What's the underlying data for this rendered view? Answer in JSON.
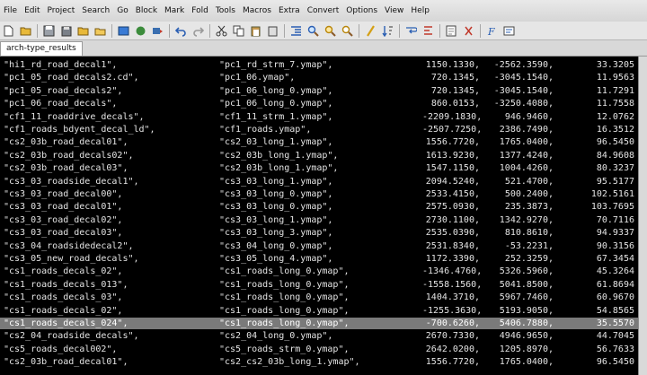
{
  "menu": [
    "File",
    "Edit",
    "Project",
    "Search",
    "Go",
    "Block",
    "Mark",
    "Fold",
    "Tools",
    "Macros",
    "Extra",
    "Convert",
    "Options",
    "View",
    "Help"
  ],
  "tab": {
    "label": "arch-type_results"
  },
  "rows": [
    [
      "\"hi1_rd_road_decal1\",",
      "\"pc1_rd_strm_7.ymap\",",
      "1150.1330,",
      "-2562.3590,",
      "33.3205"
    ],
    [
      "\"pc1_05_road_decals2.cd\",",
      "\"pc1_06.ymap\",",
      "720.1345,",
      "-3045.1540,",
      "11.9563"
    ],
    [
      "\"pc1_05_road_decals2\",",
      "\"pc1_06_long_0.ymap\",",
      "720.1345,",
      "-3045.1540,",
      "11.7291"
    ],
    [
      "\"pc1_06_road_decals\",",
      "\"pc1_06_long_0.ymap\",",
      "860.0153,",
      "-3250.4080,",
      "11.7558"
    ],
    [
      "\"cf1_11_roaddrive_decals\",",
      "\"cf1_11_strm_1.ymap\",",
      "-2209.1830,",
      "946.9460,",
      "12.0762"
    ],
    [
      "\"cf1_roads_bdyent_decal_ld\",",
      "\"cf1_roads.ymap\",",
      "-2507.7250,",
      "2386.7490,",
      "16.3512"
    ],
    [
      "\"cs2_03b_road_decal01\",",
      "\"cs2_03_long_1.ymap\",",
      "1556.7720,",
      "1765.0400,",
      "96.5450"
    ],
    [
      "\"cs2_03b_road_decals02\",",
      "\"cs2_03b_long_1.ymap\",",
      "1613.9230,",
      "1377.4240,",
      "84.9608"
    ],
    [
      "\"cs2_03b_road_decal03\",",
      "\"cs2_03b_long_1.ymap\",",
      "1547.1150,",
      "1004.4260,",
      "80.3237"
    ],
    [
      "\"cs3_03_roadside_decal1\",",
      "\"cs3_03_long_1.ymap\",",
      "2094.5240,",
      "521.4700,",
      "95.5177"
    ],
    [
      "\"cs3_03_road_decal00\",",
      "\"cs3_03_long_0.ymap\",",
      "2533.4150,",
      "500.2400,",
      "102.5161"
    ],
    [
      "\"cs3_03_road_decal01\",",
      "\"cs3_03_long_0.ymap\",",
      "2575.0930,",
      "235.3873,",
      "103.7695"
    ],
    [
      "\"cs3_03_road_decal02\",",
      "\"cs3_03_long_1.ymap\",",
      "2730.1100,",
      "1342.9270,",
      "70.7116"
    ],
    [
      "\"cs3_03_road_decal03\",",
      "\"cs3_03_long_3.ymap\",",
      "2535.0390,",
      "810.8610,",
      "94.9337"
    ],
    [
      "\"cs3_04_roadsidedecal2\",",
      "\"cs3_04_long_0.ymap\",",
      "2531.8340,",
      "-53.2231,",
      "90.3156"
    ],
    [
      "\"cs3_05_new_road_decals\",",
      "\"cs3_05_long_4.ymap\",",
      "1172.3390,",
      "252.3259,",
      "67.3454"
    ],
    [
      "\"cs1_roads_decals_02\",",
      "\"cs1_roads_long_0.ymap\",",
      "-1346.4760,",
      "5326.5960,",
      "45.3264"
    ],
    [
      "\"cs1_roads_decals_013\",",
      "\"cs1_roads_long_0.ymap\",",
      "-1558.1560,",
      "5041.8500,",
      "61.8694"
    ],
    [
      "\"cs1_roads_decals_03\",",
      "\"cs1_roads_long_0.ymap\",",
      "1404.3710,",
      "5967.7460,",
      "60.9670"
    ],
    [
      "\"cs1_roads_decals_02\",",
      "\"cs1_roads_long_0.ymap\",",
      "-1255.3630,",
      "5193.9050,",
      "54.8565"
    ],
    [
      "\"cs1_roads_decals_024\",",
      "\"cs1_roads_long_0.ymap\",",
      "-700.6260,",
      "5406.7880,",
      "35.5570"
    ],
    [
      "\"cs2_04_roadside_decals\",",
      "\"cs2_04_long_0.ymap\",",
      "2670.7330,",
      "4946.9650,",
      "44.7045"
    ],
    [
      "\"cs5_roads_decal002\",",
      "\"cs5_roads_strm_0.ymap\",",
      "2642.0200,",
      "1205.8970,",
      "56.7633"
    ],
    [
      "\"cs2_03b_road_decal01\",",
      "\"cs2_cs2_03b_long_1.ymap\",",
      "1556.7720,",
      "1765.0400,",
      "96.5450"
    ]
  ],
  "selected_row": 20
}
